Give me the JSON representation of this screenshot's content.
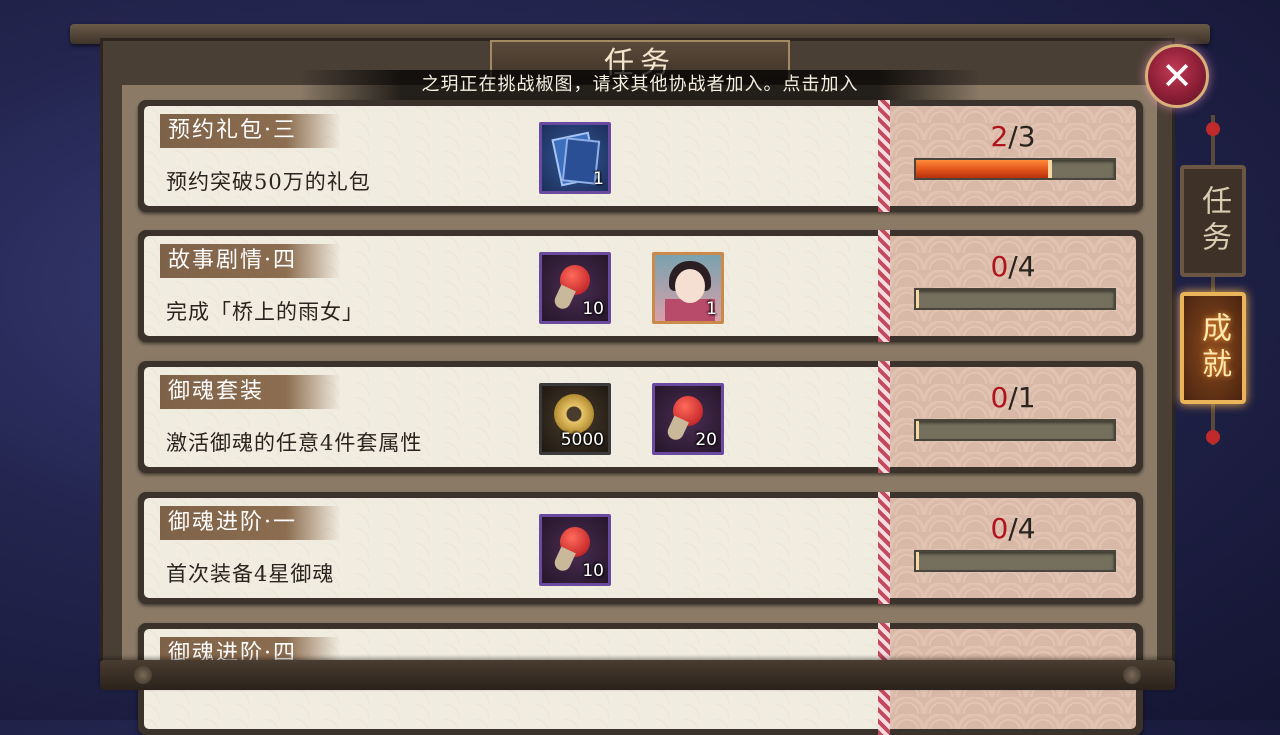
{
  "window": {
    "title": "任务"
  },
  "notice": "之玥正在挑战椒图，请求其他协战者加入。点击加入",
  "tabs": [
    {
      "label": "任务",
      "active": false
    },
    {
      "label": "成就",
      "active": true
    }
  ],
  "tasks": [
    {
      "name": "预约礼包·三",
      "desc": "预约突破50万的礼包",
      "rewards": [
        {
          "icon": "ticket-book-icon",
          "count": "1"
        }
      ],
      "current": "2",
      "total": "3",
      "progress": 0.667
    },
    {
      "name": "故事剧情·四",
      "desc": "完成「桥上的雨女」",
      "rewards": [
        {
          "icon": "red-magatama-icon",
          "count": "10"
        },
        {
          "icon": "shikigami-portrait-icon",
          "count": "1"
        }
      ],
      "current": "0",
      "total": "4",
      "progress": 0
    },
    {
      "name": "御魂套装",
      "desc": "激活御魂的任意4件套属性",
      "rewards": [
        {
          "icon": "gold-coin-icon",
          "count": "5000"
        },
        {
          "icon": "red-magatama-icon",
          "count": "20"
        }
      ],
      "current": "0",
      "total": "1",
      "progress": 0
    },
    {
      "name": "御魂进阶·一",
      "desc": "首次装备4星御魂",
      "rewards": [
        {
          "icon": "red-magatama-icon",
          "count": "10"
        }
      ],
      "current": "0",
      "total": "4",
      "progress": 0
    },
    {
      "name": "御魂进阶·四",
      "desc": "",
      "rewards": [],
      "current": "",
      "total": "",
      "progress": 0
    }
  ],
  "colors": {
    "accent_red": "#b0141c",
    "bar_fill": "#e0541a",
    "tab_glow": "#f0b050"
  }
}
